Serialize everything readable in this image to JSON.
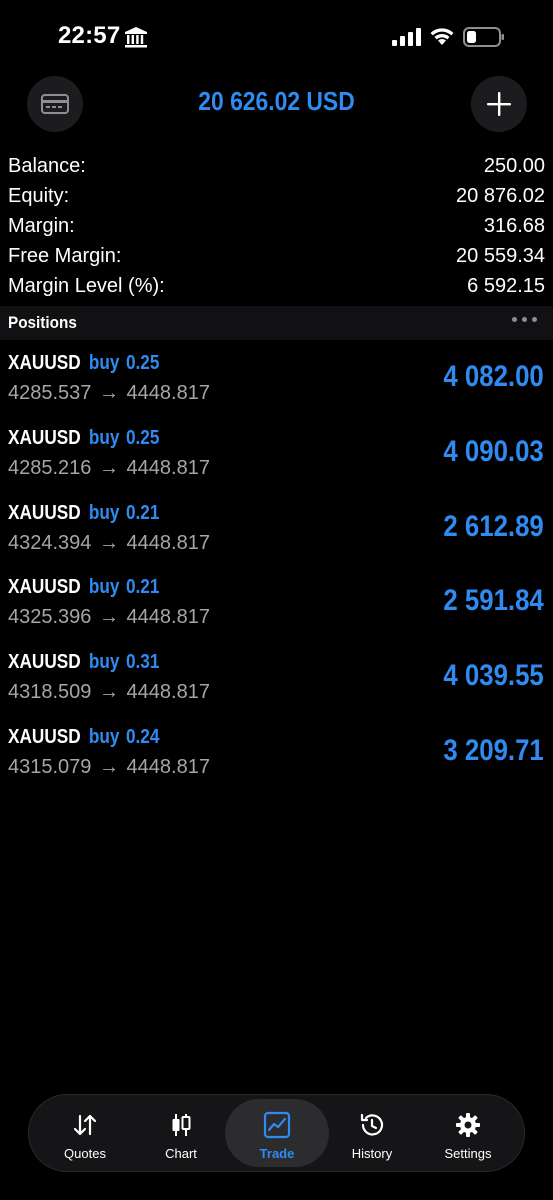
{
  "status_bar": {
    "time": "22:57"
  },
  "header": {
    "title": "20 626.02 USD"
  },
  "summary": [
    {
      "label": "Balance:",
      "value": "250.00"
    },
    {
      "label": "Equity:",
      "value": "20 876.02"
    },
    {
      "label": "Margin:",
      "value": "316.68"
    },
    {
      "label": "Free Margin:",
      "value": "20 559.34"
    },
    {
      "label": "Margin Level (%):",
      "value": "6 592.15"
    }
  ],
  "positions": {
    "title": "Positions",
    "items": [
      {
        "symbol": "XAUUSD",
        "direction": "buy",
        "lot": "0.25",
        "open_price": "4285.537",
        "arrow": "→",
        "current_price": "4448.817",
        "profit": "4 082.00"
      },
      {
        "symbol": "XAUUSD",
        "direction": "buy",
        "lot": "0.25",
        "open_price": "4285.216",
        "arrow": "→",
        "current_price": "4448.817",
        "profit": "4 090.03"
      },
      {
        "symbol": "XAUUSD",
        "direction": "buy",
        "lot": "0.21",
        "open_price": "4324.394",
        "arrow": "→",
        "current_price": "4448.817",
        "profit": "2 612.89"
      },
      {
        "symbol": "XAUUSD",
        "direction": "buy",
        "lot": "0.21",
        "open_price": "4325.396",
        "arrow": "→",
        "current_price": "4448.817",
        "profit": "2 591.84"
      },
      {
        "symbol": "XAUUSD",
        "direction": "buy",
        "lot": "0.31",
        "open_price": "4318.509",
        "arrow": "→",
        "current_price": "4448.817",
        "profit": "4 039.55"
      },
      {
        "symbol": "XAUUSD",
        "direction": "buy",
        "lot": "0.24",
        "open_price": "4315.079",
        "arrow": "→",
        "current_price": "4448.817",
        "profit": "3 209.71"
      }
    ]
  },
  "tabs": [
    {
      "label": "Quotes",
      "icon": "quotes-arrows-icon",
      "active": false
    },
    {
      "label": "Chart",
      "icon": "candlestick-icon",
      "active": false
    },
    {
      "label": "Trade",
      "icon": "trade-chart-icon",
      "active": true
    },
    {
      "label": "History",
      "icon": "history-icon",
      "active": false
    },
    {
      "label": "Settings",
      "icon": "gear-icon",
      "active": false
    }
  ],
  "colors": {
    "accent": "#2f8bf0",
    "background": "#000000",
    "secondary_text": "#a5a5aa"
  }
}
